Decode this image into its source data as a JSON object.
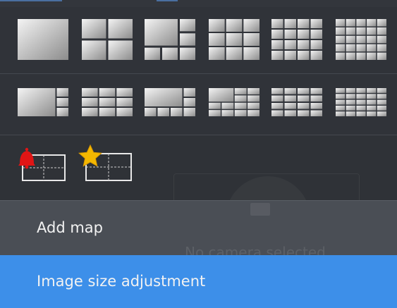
{
  "colors": {
    "panel_bg": "#2e3136",
    "tile_gradient_light": "#f4f4f4",
    "tile_gradient_dark": "#8c8c8c",
    "menu_item_bg": "#4a4e55",
    "menu_item_selected_bg": "#3d8fe9",
    "menu_text": "#f2f2f2",
    "alarm_red": "#e01515",
    "star_gold": "#f5b800"
  },
  "layouts_row1": [
    {
      "icon": "layout-1-icon"
    },
    {
      "icon": "layout-2x2-icon"
    },
    {
      "icon": "layout-1-plus-5-icon"
    },
    {
      "icon": "layout-3x3-icon"
    },
    {
      "icon": "layout-4x4-icon"
    },
    {
      "icon": "layout-5x5-icon"
    }
  ],
  "layouts_row2": [
    {
      "icon": "layout-wide-1-plus-3-icon"
    },
    {
      "icon": "layout-wide-3x3-icon"
    },
    {
      "icon": "layout-wide-1-plus-7-icon"
    },
    {
      "icon": "layout-wide-1-plus-12-icon"
    },
    {
      "icon": "layout-wide-4x4-icon"
    },
    {
      "icon": "layout-wide-5x5-icon"
    }
  ],
  "special_layouts": [
    {
      "icon": "alarm-layout-icon"
    },
    {
      "icon": "favorite-layout-icon"
    }
  ],
  "menu": {
    "add_map": "Add map",
    "image_size_adjustment": "Image size adjustment"
  },
  "background": {
    "ghost_text": "No camera selected"
  }
}
